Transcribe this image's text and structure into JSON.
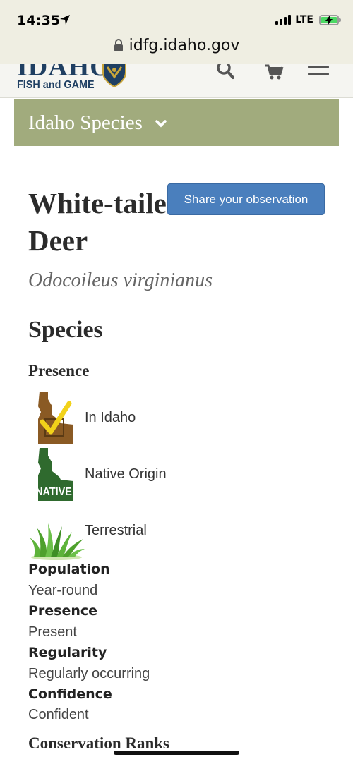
{
  "status_bar": {
    "time": "14:35",
    "network": "LTE"
  },
  "browser": {
    "url": "idfg.idaho.gov"
  },
  "header": {
    "logo_main": "IDAHO",
    "logo_sub": "FISH and GAME",
    "icons": [
      "search-icon",
      "cart-icon",
      "menu-icon"
    ]
  },
  "nav": {
    "species_dropdown": "Idaho Species"
  },
  "species": {
    "common_name": "White-tailed Deer",
    "scientific_name": "Odocoileus virginianus",
    "share_button": "Share your observation",
    "section_title": "Species",
    "presence_heading": "Presence",
    "presence_items": [
      {
        "label": "In Idaho",
        "icon": "idaho-check-icon",
        "color": "#8a5a24"
      },
      {
        "label": "Native Origin",
        "icon": "idaho-native-icon",
        "badge": "NATIVE",
        "color": "#2f6a2e"
      },
      {
        "label": "Terrestrial",
        "icon": "grass-icon",
        "color": "#4ea02c"
      }
    ],
    "details": [
      {
        "term": "Population",
        "value": "Year-round"
      },
      {
        "term": "Presence",
        "value": "Present"
      },
      {
        "term": "Regularity",
        "value": "Regularly occurring"
      },
      {
        "term": "Confidence",
        "value": "Confident"
      }
    ],
    "conservation_heading": "Conservation Ranks"
  },
  "colors": {
    "browser_chrome": "#efeee2",
    "species_band": "#a1ab7d",
    "share_button": "#4a7fbd",
    "logo_navy": "#1f3f62"
  }
}
